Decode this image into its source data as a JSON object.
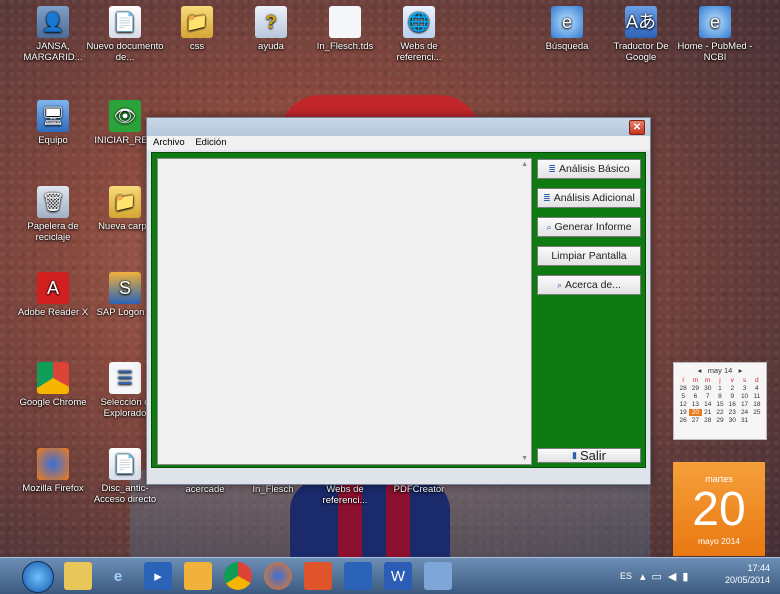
{
  "desktop": {
    "icons": [
      {
        "label": "JANSA, MARGARID...",
        "glyph": "👤"
      },
      {
        "label": "Nuevo documento de...",
        "glyph": "📄"
      },
      {
        "label": "css",
        "glyph": "📁"
      },
      {
        "label": "ayuda",
        "glyph": "?"
      },
      {
        "label": "In_Flesch.tds",
        "glyph": ""
      },
      {
        "label": "Webs de referenci...",
        "glyph": "🌐"
      },
      {
        "label": "Búsqueda",
        "glyph": "e"
      },
      {
        "label": "Traductor De Google",
        "glyph": "Aあ"
      },
      {
        "label": "Home - PubMed - NCBI",
        "glyph": "e"
      },
      {
        "label": "Equipo",
        "glyph": "🖥"
      },
      {
        "label": "INICIAR_REM",
        "glyph": "👁"
      },
      {
        "label": "Papelera de reciclaje",
        "glyph": "🗑"
      },
      {
        "label": "Nueva carpe",
        "glyph": "📁"
      },
      {
        "label": "Adobe Reader X",
        "glyph": "A"
      },
      {
        "label": "SAP Logon P",
        "glyph": "S"
      },
      {
        "label": "Google Chrome",
        "glyph": ""
      },
      {
        "label": "Selección d Explorado",
        "glyph": "☰"
      },
      {
        "label": "Mozilla Firefox",
        "glyph": ""
      },
      {
        "label": "Disc_antic- Acceso directo",
        "glyph": "📄"
      },
      {
        "label": "acercade",
        "glyph": ""
      },
      {
        "label": "In_Flesch",
        "glyph": ""
      },
      {
        "label": "Webs de referenci...",
        "glyph": ""
      },
      {
        "label": "PDFCreator",
        "glyph": ""
      }
    ]
  },
  "app": {
    "close_glyph": "✕",
    "menu": {
      "archivo": "Archivo",
      "edicion": "Edición"
    },
    "buttons": {
      "analisis_basico": "Análisis Básico",
      "analisis_adicional": "Análisis Adicional",
      "generar_informe": "Generar Informe",
      "limpiar_pantalla": "Limpiar Pantalla",
      "acerca_de": "Acerca de...",
      "salir": "Salir"
    }
  },
  "calendar": {
    "month": "may 14",
    "weekdays": [
      "l",
      "m",
      "m",
      "j",
      "v",
      "s",
      "d"
    ],
    "rows": [
      [
        "28",
        "29",
        "30",
        "1",
        "2",
        "3",
        "4"
      ],
      [
        "5",
        "6",
        "7",
        "8",
        "9",
        "10",
        "11"
      ],
      [
        "12",
        "13",
        "14",
        "15",
        "16",
        "17",
        "18"
      ],
      [
        "19",
        "20",
        "21",
        "22",
        "23",
        "24",
        "25"
      ],
      [
        "26",
        "27",
        "28",
        "29",
        "30",
        "31",
        ""
      ]
    ],
    "today": "20"
  },
  "date_tile": {
    "weekday": "martes",
    "day": "20",
    "month_year": "mayo 2014"
  },
  "taskbar": {
    "language": "ES",
    "time": "17:44",
    "date": "20/05/2014"
  }
}
